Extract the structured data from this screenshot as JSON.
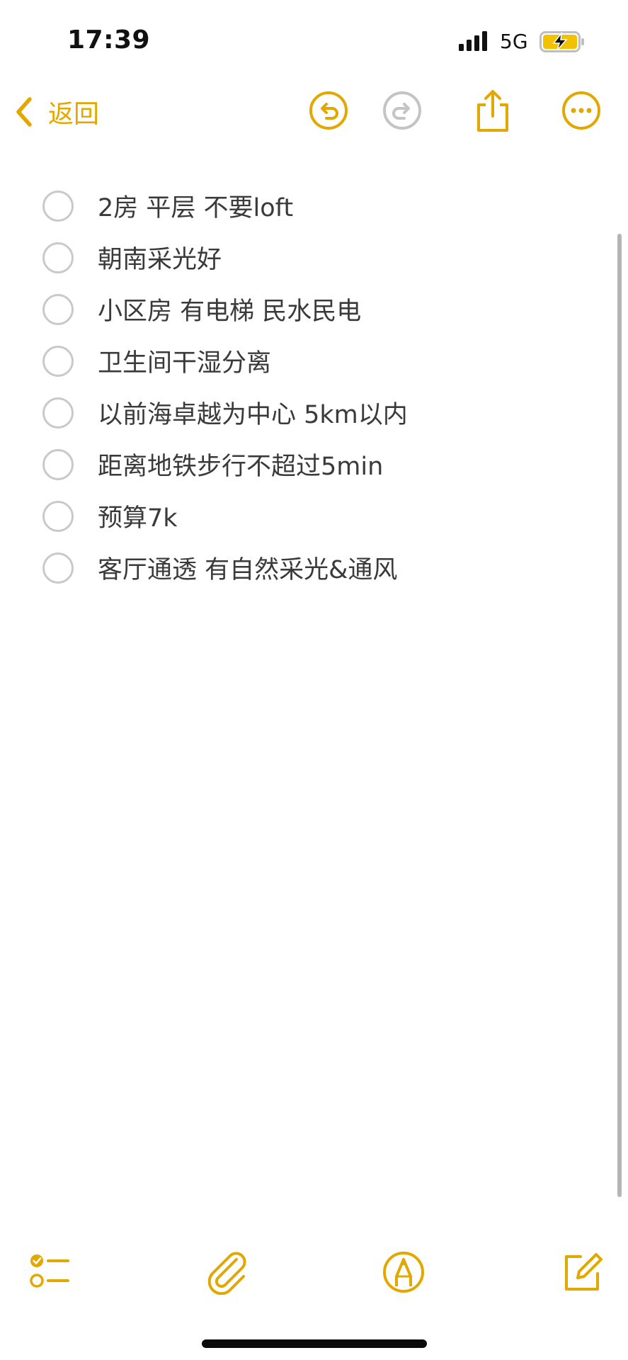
{
  "status_bar": {
    "time": "17:39",
    "network": "5G",
    "signal_icon": "cellular-signal-icon",
    "battery_icon": "battery-charging-icon"
  },
  "nav": {
    "back_label": "返回",
    "back_icon": "chevron-left-icon",
    "undo_icon": "undo-icon",
    "redo_icon": "redo-icon",
    "share_icon": "share-icon",
    "more_icon": "more-icon"
  },
  "checklist": {
    "items": [
      {
        "label": "2房 平层 不要loft",
        "checked": false
      },
      {
        "label": "朝南采光好",
        "checked": false
      },
      {
        "label": "小区房 有电梯 民水民电",
        "checked": false
      },
      {
        "label": "卫生间干湿分离",
        "checked": false
      },
      {
        "label": "以前海卓越为中心 5km以内",
        "checked": false
      },
      {
        "label": "距离地铁步行不超过5min",
        "checked": false
      },
      {
        "label": "预算7k",
        "checked": false
      },
      {
        "label": "客厅通透 有自然采光&通风",
        "checked": false
      }
    ]
  },
  "toolbar": {
    "checklist_icon": "checklist-icon",
    "attachment_icon": "paperclip-icon",
    "markup_icon": "markup-pen-icon",
    "compose_icon": "compose-icon"
  },
  "colors": {
    "accent": "#e3a800",
    "disabled": "#c4c4c4",
    "text": "#3a3a3a"
  }
}
